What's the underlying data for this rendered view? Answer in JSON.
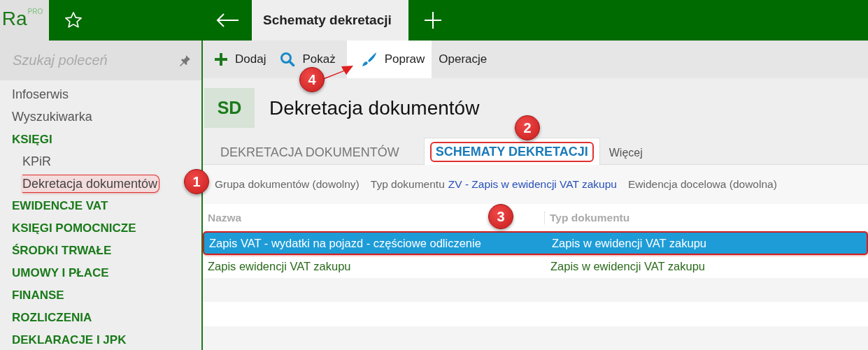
{
  "topbar": {
    "logo": "Ra",
    "logo_badge": "PRO",
    "tabs": [
      {
        "label": "Schematy dekretacji",
        "selected": true
      }
    ]
  },
  "sidebar": {
    "search": {
      "placeholder": "Szukaj poleceń"
    },
    "items": [
      {
        "label": "Infoserwis",
        "kind": "link",
        "selected": false,
        "highlighted": false
      },
      {
        "label": "Wyszukiwarka",
        "kind": "link",
        "selected": false,
        "highlighted": false
      },
      {
        "label": "KSIĘGI",
        "kind": "section",
        "selected": false,
        "highlighted": false,
        "children": [
          {
            "label": "KPiR",
            "kind": "link",
            "selected": false,
            "highlighted": false
          },
          {
            "label": "Dekretacja dokumentów",
            "kind": "link",
            "selected": true,
            "highlighted": true
          }
        ]
      },
      {
        "label": "EWIDENCJE VAT",
        "kind": "section",
        "selected": false,
        "highlighted": false
      },
      {
        "label": "KSIĘGI POMOCNICZE",
        "kind": "section",
        "selected": false,
        "highlighted": false
      },
      {
        "label": "ŚRODKI TRWAŁE",
        "kind": "section",
        "selected": false,
        "highlighted": false
      },
      {
        "label": "UMOWY I PŁACE",
        "kind": "section",
        "selected": false,
        "highlighted": false
      },
      {
        "label": "FINANSE",
        "kind": "section",
        "selected": false,
        "highlighted": false
      },
      {
        "label": "ROZLICZENIA",
        "kind": "section",
        "selected": false,
        "highlighted": false
      },
      {
        "label": "DEKLARACJE I JPK",
        "kind": "section",
        "selected": false,
        "highlighted": false
      }
    ]
  },
  "toolbar": {
    "buttons": [
      {
        "label": "Dodaj",
        "kind": "add",
        "selected": false
      },
      {
        "label": "Pokaż",
        "kind": "search",
        "selected": false
      },
      {
        "label": "Popraw",
        "kind": "edit",
        "selected": true
      },
      {
        "label": "Operacje",
        "kind": "plain",
        "selected": false
      }
    ]
  },
  "header": {
    "badge": "SD",
    "title": "Dekretacja dokumentów"
  },
  "tabs": [
    {
      "label": "DEKRETACJA DOKUMENTÓW",
      "selected": false,
      "highlighted": false
    },
    {
      "label": "SCHEMATY DEKRETACJI",
      "selected": true,
      "highlighted": true
    },
    {
      "label": "Więcej",
      "selected": false,
      "highlighted": false
    }
  ],
  "filters": [
    {
      "label": "Grupa dokumentów (dowolny)"
    },
    {
      "label": "Typ dokumentu",
      "value": "ZV - Zapis w ewidencji VAT zakupu"
    },
    {
      "label": "Ewidencja docelowa (dowolna)"
    }
  ],
  "table": {
    "columns": [
      "Nazwa",
      "Typ dokumentu"
    ],
    "rows": [
      {
        "cells": [
          "Zapis VAT - wydatki na pojazd - częściowe odliczenie",
          "Zapis w ewidencji VAT zakupu"
        ],
        "selected": true,
        "highlighted": true
      },
      {
        "cells": [
          "Zapis ewidencji VAT zakupu",
          "Zapis w ewidencji VAT zakupu"
        ],
        "selected": false,
        "highlighted": false
      }
    ]
  },
  "callouts": [
    {
      "number": "1",
      "pointer": false
    },
    {
      "number": "2",
      "pointer": false
    },
    {
      "number": "3",
      "pointer": false
    },
    {
      "number": "4",
      "pointer": true
    }
  ]
}
